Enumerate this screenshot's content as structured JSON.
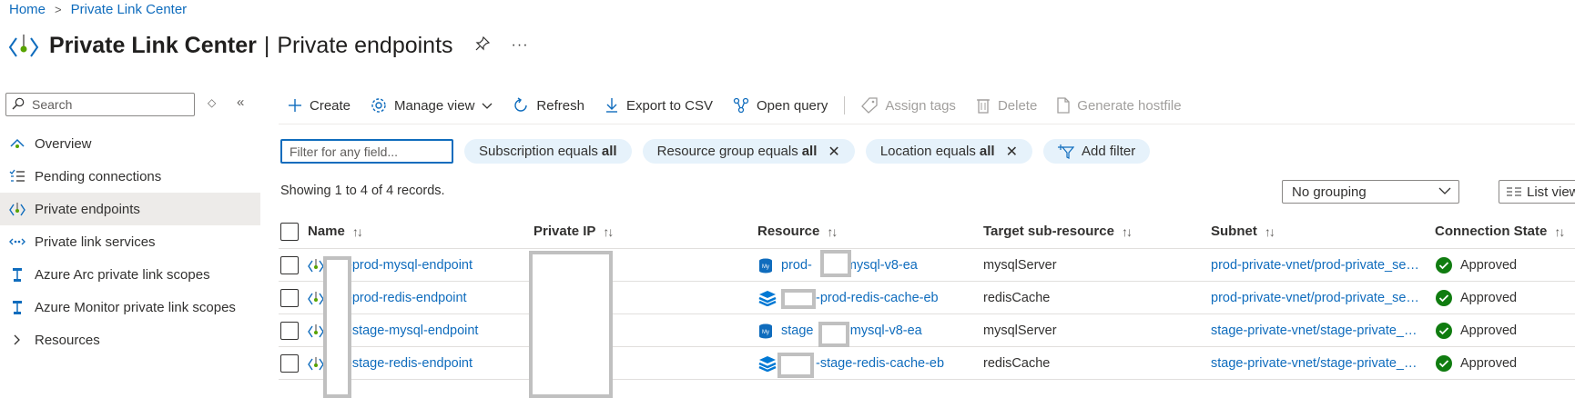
{
  "breadcrumb": {
    "home": "Home",
    "current": "Private Link Center"
  },
  "header": {
    "title": "Private Link Center",
    "separator": "|",
    "subtitle": "Private endpoints",
    "more": "···"
  },
  "sidebar": {
    "search_placeholder": "Search",
    "items": [
      {
        "label": "Overview",
        "icon": "overview-icon"
      },
      {
        "label": "Pending connections",
        "icon": "pending-list-icon"
      },
      {
        "label": "Private endpoints",
        "icon": "private-endpoint-icon",
        "active": true
      },
      {
        "label": "Private link services",
        "icon": "private-link-service-icon"
      },
      {
        "label": "Azure Arc private link scopes",
        "icon": "arc-scope-icon"
      },
      {
        "label": "Azure Monitor private link scopes",
        "icon": "monitor-scope-icon"
      },
      {
        "label": "Resources",
        "icon": "chevron-right-icon"
      }
    ]
  },
  "toolbar": {
    "create": "Create",
    "manage_view": "Manage view",
    "refresh": "Refresh",
    "export_csv": "Export to CSV",
    "open_query": "Open query",
    "assign_tags": "Assign tags",
    "delete": "Delete",
    "generate_hostfile": "Generate hostfile"
  },
  "filters": {
    "placeholder": "Filter for any field...",
    "subscription": {
      "label": "Subscription equals",
      "value": "all"
    },
    "resource_group": {
      "label": "Resource group equals",
      "value": "all"
    },
    "location": {
      "label": "Location equals",
      "value": "all"
    },
    "add_filter": "Add filter"
  },
  "records_text": "Showing 1 to 4 of 4 records.",
  "grouping": "No grouping",
  "list_view": "List view",
  "table": {
    "columns": {
      "name": "Name",
      "private_ip": "Private IP",
      "resource": "Resource",
      "target": "Target sub-resource",
      "subnet": "Subnet",
      "state": "Connection State"
    },
    "rows": [
      {
        "name": "-prod-mysql-endpoint",
        "resource": "prod-        -mysql-v8-ea",
        "resource_type": "mysql",
        "target": "mysqlServer",
        "subnet": "prod-private-vnet/prod-private_ser...",
        "state": "Approved"
      },
      {
        "name": "-prod-redis-endpoint",
        "resource": "-prod-redis-cache-eb",
        "resource_type": "redis",
        "target": "redisCache",
        "subnet": "prod-private-vnet/prod-private_ser...",
        "state": "Approved"
      },
      {
        "name": "-stage-mysql-endpoint",
        "resource": "stage       c-mysql-v8-ea",
        "resource_type": "mysql",
        "target": "mysqlServer",
        "subnet": "stage-private-vnet/stage-private_s...",
        "state": "Approved"
      },
      {
        "name": "-stage-redis-endpoint",
        "resource": "-stage-redis-cache-eb",
        "resource_type": "redis",
        "target": "redisCache",
        "subnet": "stage-private-vnet/stage-private_s...",
        "state": "Approved"
      }
    ]
  },
  "colors": {
    "link": "#0f6cbd",
    "pill_bg": "#e6f2fb",
    "approved": "#107c10"
  }
}
